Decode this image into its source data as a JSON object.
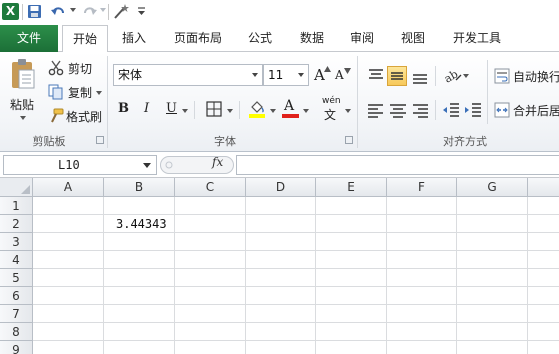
{
  "quick_access": {
    "app_icon_letter": "X",
    "icons": [
      "excel-logo-icon",
      "save-icon",
      "undo-icon",
      "redo-icon",
      "macro-wand-icon",
      "customize-toolbar-icon"
    ]
  },
  "tabs": {
    "file": "文件",
    "items": [
      {
        "label": "开始",
        "active": true
      },
      {
        "label": "插入",
        "active": false
      },
      {
        "label": "页面布局",
        "active": false
      },
      {
        "label": "公式",
        "active": false
      },
      {
        "label": "数据",
        "active": false
      },
      {
        "label": "审阅",
        "active": false
      },
      {
        "label": "视图",
        "active": false
      },
      {
        "label": "开发工具",
        "active": false
      }
    ]
  },
  "ribbon": {
    "clipboard": {
      "paste": "粘贴",
      "cut": "剪切",
      "copy": "复制",
      "format_painter": "格式刷",
      "group_label": "剪贴板"
    },
    "font": {
      "font_name": "宋体",
      "font_size": "11",
      "bold": "B",
      "italic": "I",
      "underline": "U",
      "phonetic": "wén",
      "increase_font": "A",
      "decrease_font": "A",
      "font_color_letter": "A",
      "group_label": "字体",
      "highlight_color": "#ffff00",
      "font_color": "#e0201b"
    },
    "alignment": {
      "wrap_text": "自动换行",
      "merge_center": "合并后居",
      "group_label": "对齐方式"
    }
  },
  "formula_bar": {
    "name_box": "L10",
    "fx_label": "fx",
    "formula": ""
  },
  "sheet": {
    "columns": [
      "A",
      "B",
      "C",
      "D",
      "E",
      "F",
      "G"
    ],
    "rows": [
      "1",
      "2",
      "3",
      "4",
      "5",
      "6",
      "7",
      "8",
      "9"
    ],
    "cells": {
      "B2": "3.44343"
    }
  },
  "colors": {
    "file_tab": "#1f7a3d",
    "accent_selected": "#f7c95a"
  }
}
